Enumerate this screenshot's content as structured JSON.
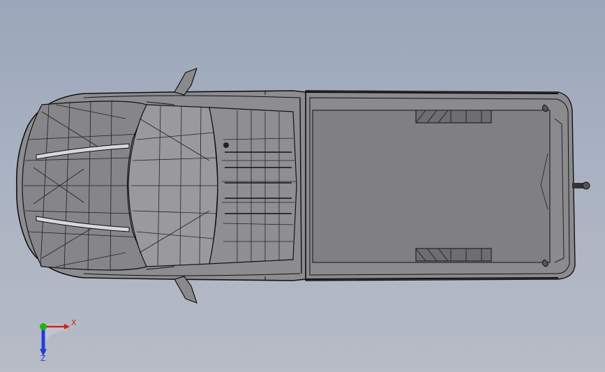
{
  "view": {
    "background_top": "#9aa6b9",
    "background_bottom": "#b7bcc6",
    "model_fill": "#8a8a8e",
    "model_edges": "#1a1a1a",
    "bed_floor": "#7d7d80"
  },
  "triad": {
    "x_label": "X",
    "z_label": "Z",
    "x_color": "#d62020",
    "y_color": "#18b818",
    "z_color": "#1f3fd8"
  }
}
